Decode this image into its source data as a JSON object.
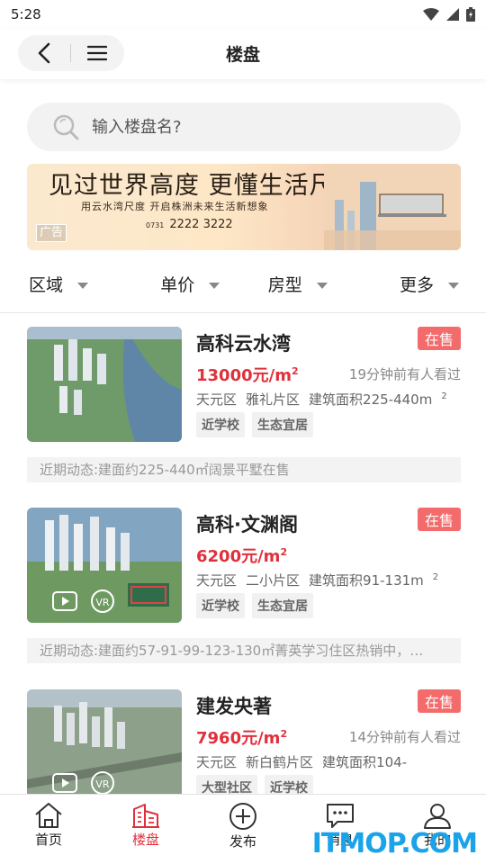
{
  "status_bar": {
    "time": "5:28"
  },
  "header": {
    "title": "楼盘"
  },
  "search": {
    "placeholder": "输入楼盘名?"
  },
  "banner": {
    "headline": "见过世界高度 更懂生活尺度",
    "subline": "用云水湾尺度 开启株洲未来生活新想象",
    "phone_prefix": "0731",
    "phone": "2222 3222",
    "ad_label": "广告"
  },
  "filters": [
    {
      "label": "区域"
    },
    {
      "label": "单价"
    },
    {
      "label": "房型"
    },
    {
      "label": "更多"
    }
  ],
  "listings": [
    {
      "name": "高科云水湾",
      "status": "在售",
      "price": "13000元/m",
      "price_sup": "2",
      "viewed": "19分钟前有人看过",
      "district": "天元区",
      "area": "雅礼片区",
      "building_area": "建筑面积225-440m",
      "building_area_sup": "2",
      "tags": [
        "近学校",
        "生态宜居"
      ],
      "news": "近期动态:建面约225-440㎡阔景平墅在售"
    },
    {
      "name": "高科·文渊阁",
      "status": "在售",
      "price": "6200元/m",
      "price_sup": "2",
      "viewed": "",
      "district": "天元区",
      "area": "二小片区",
      "building_area": "建筑面积91-131m",
      "building_area_sup": "2",
      "tags": [
        "近学校",
        "生态宜居"
      ],
      "news": "近期动态:建面约57-91-99-123-130㎡菁英学习住区热销中，…"
    },
    {
      "name": "建发央著",
      "status": "在售",
      "price": "7960元/m",
      "price_sup": "2",
      "viewed": "14分钟前有人看过",
      "district": "天元区",
      "area": "新白鹤片区",
      "building_area": "建筑面积104-",
      "building_area_sup": "",
      "tags": [
        "大型社区",
        "近学校"
      ],
      "news": ""
    }
  ],
  "tabbar": [
    {
      "label": "首页"
    },
    {
      "label": "楼盘"
    },
    {
      "label": "发布"
    },
    {
      "label": "消息"
    },
    {
      "label": "我的"
    }
  ],
  "watermark": "ITMOP.COM",
  "colors": {
    "accent": "#e0303c",
    "status_badge": "#f36b6b"
  }
}
